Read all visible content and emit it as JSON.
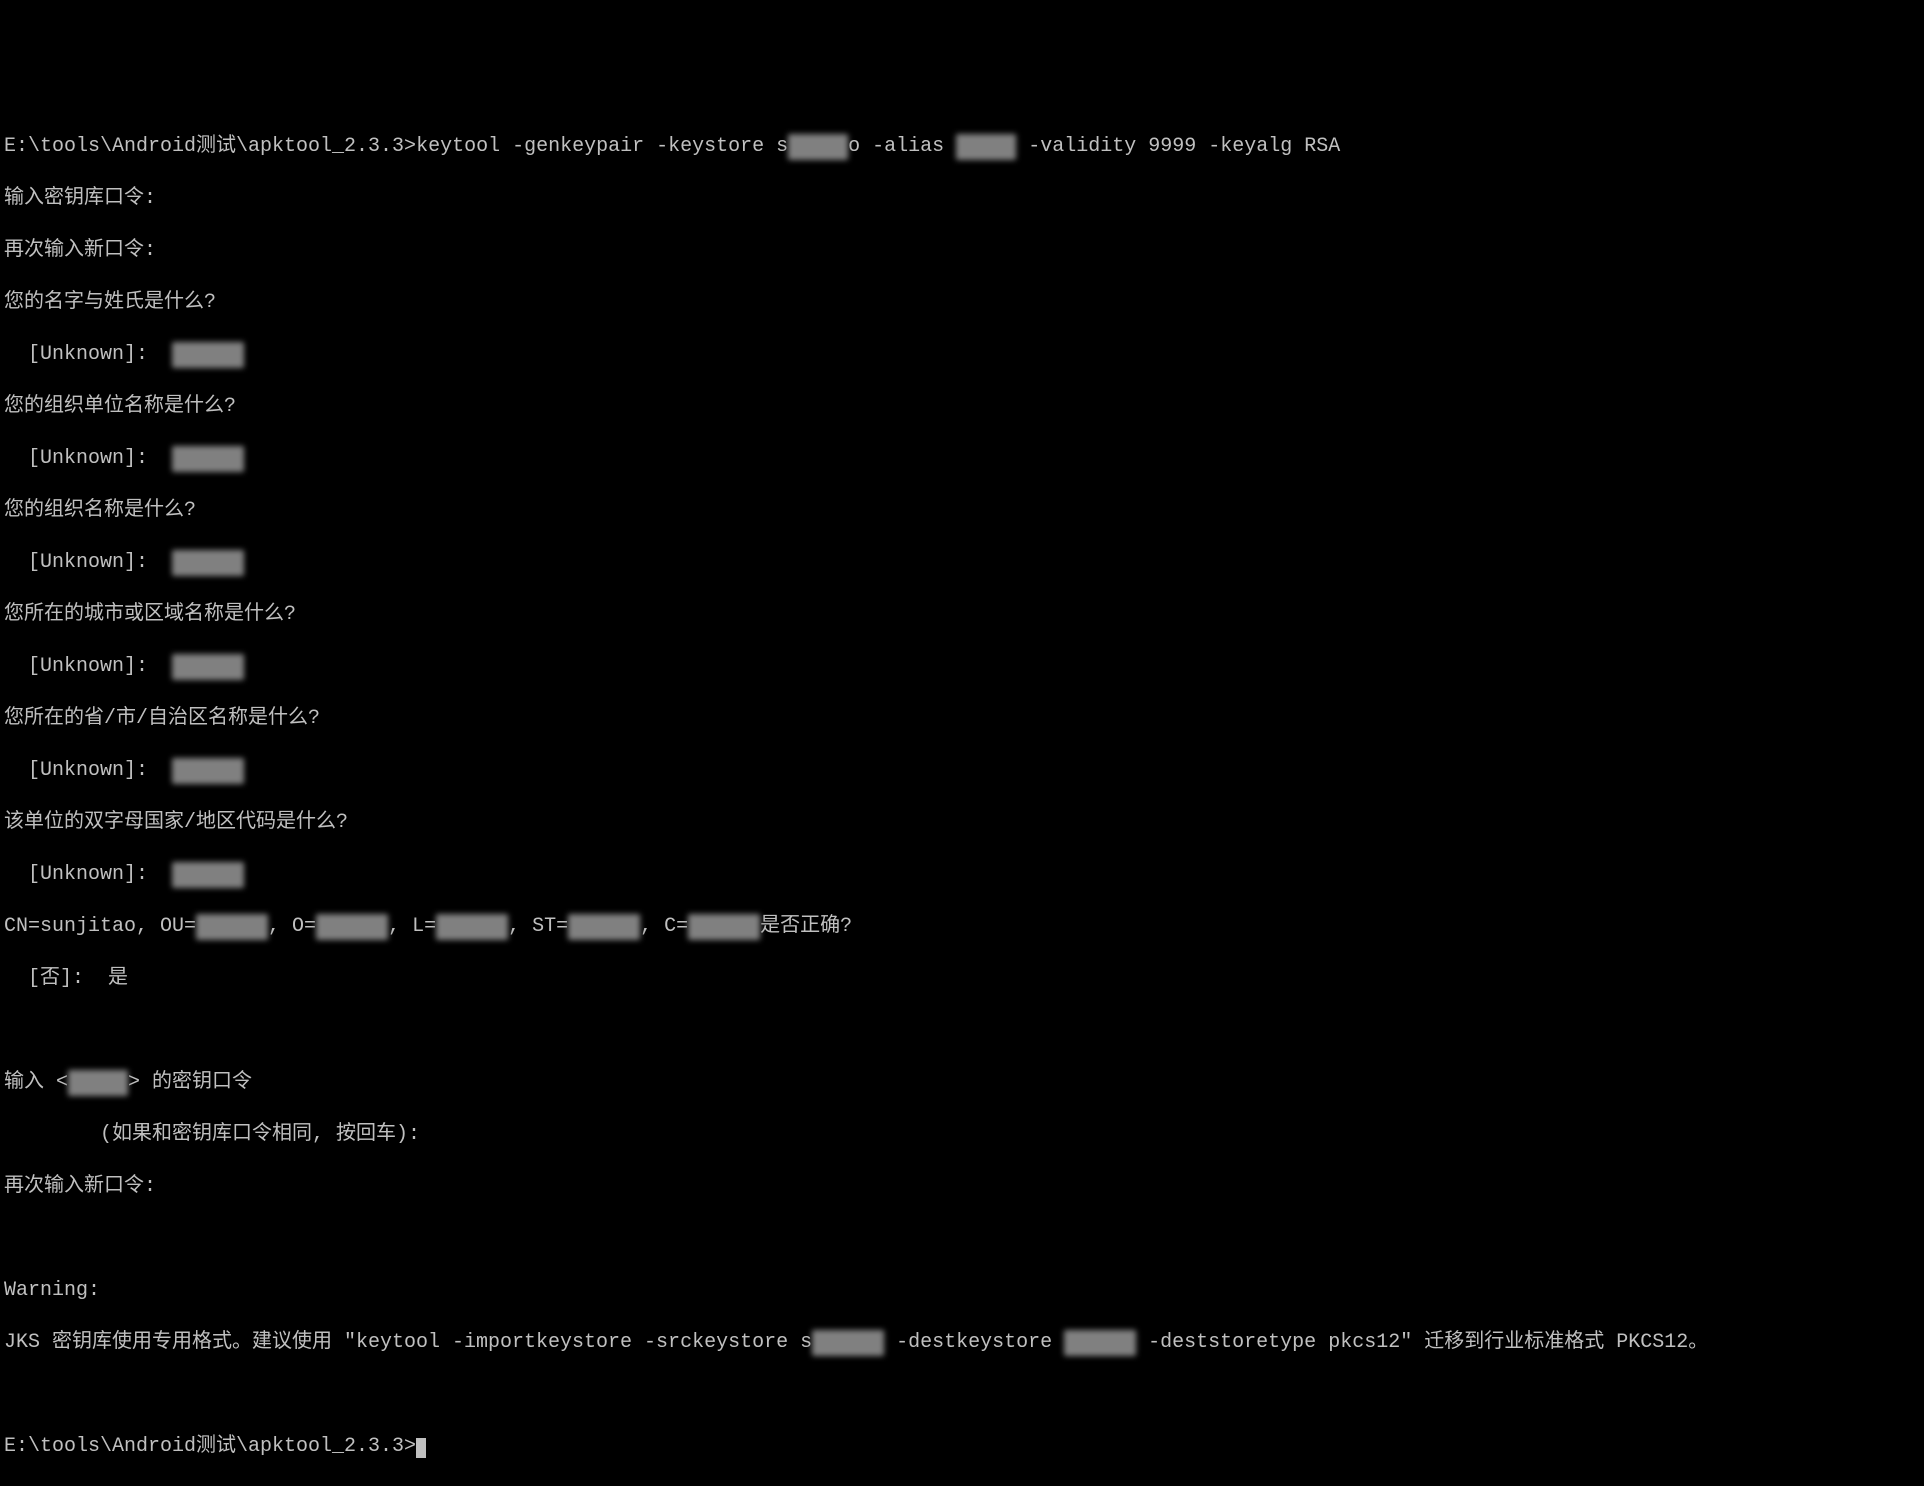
{
  "terminal": {
    "prompt1_path": "E:\\tools\\Android测试\\apktool_2.3.3>",
    "command": "keytool -genkeypair -keystore s",
    "command_redacted1": "u▓▓▓▓",
    "command_mid": "o -alias ",
    "command_redacted2": "▓▓▓▓▓",
    "command_end": " -validity 9999 -keyalg RSA",
    "line_enter_keystore_pwd": "输入密钥库口令:",
    "line_reenter_pwd": "再次输入新口令:",
    "q_name": "您的名字与姓氏是什么?",
    "unknown_prompt": "  [Unknown]:  ",
    "redacted_answer": "▓▓▓▓▓▓",
    "q_org_unit": "您的组织单位名称是什么?",
    "q_org": "您的组织名称是什么?",
    "q_city": "您所在的城市或区域名称是什么?",
    "q_state": "您所在的省/市/自治区名称是什么?",
    "q_country": "该单位的双字母国家/地区代码是什么?",
    "dn_cn": "CN=sunjitao, OU=",
    "dn_r1": "▓▓▓▓▓▓",
    "dn_o": ", O=",
    "dn_r2": "▓▓▓▓▓▓",
    "dn_l": ", L=",
    "dn_r3": "▓▓▓▓▓▓",
    "dn_st": ", ST=",
    "dn_r4": "▓▓▓▓▓▓",
    "dn_c": ", C=",
    "dn_r5": "▓▓▓▓▓▓",
    "dn_confirm": "是否正确?",
    "confirm_no": "  [否]:  是",
    "enter_key_pwd_pre": "输入 <",
    "enter_key_pwd_red": "▓▓▓▓▓",
    "enter_key_pwd_post": "> 的密钥口令",
    "same_as_keystore": "        (如果和密钥库口令相同, 按回车):",
    "reenter_new_pwd": "再次输入新口令:",
    "warning_label": "Warning:",
    "warning_body_pre": "JKS 密钥库使用专用格式。建议使用 \"keytool -importkeystore -srckeystore s",
    "warning_r1": "▓▓▓▓▓▓",
    "warning_mid": " -destkeystore ",
    "warning_r2": "▓▓▓▓▓▓",
    "warning_body_post": " -deststoretype pkcs12\" 迁移到行业标准格式 PKCS12。",
    "prompt2_path": "E:\\tools\\Android测试\\apktool_2.3.3>"
  }
}
